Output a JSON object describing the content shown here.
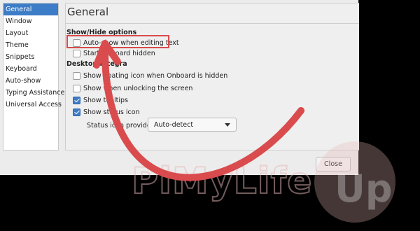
{
  "sidebar": {
    "items": [
      {
        "label": "General",
        "selected": true
      },
      {
        "label": "Window"
      },
      {
        "label": "Layout"
      },
      {
        "label": "Theme"
      },
      {
        "label": "Snippets"
      },
      {
        "label": "Keyboard"
      },
      {
        "label": "Auto-show"
      },
      {
        "label": "Typing Assistance"
      },
      {
        "label": "Universal Access"
      }
    ]
  },
  "panel": {
    "title": "General",
    "show_hide": {
      "title": "Show/Hide options",
      "auto_show": {
        "label": "Auto-show when editing text",
        "checked": false
      },
      "start_hidden": {
        "label": "Start Onboard hidden",
        "checked": false
      }
    },
    "desktop": {
      "title": "Desktop Integra",
      "floating_icon": {
        "label": "Show floating icon when Onboard is hidden",
        "checked": false
      },
      "unlocking": {
        "label": "Show when unlocking the screen",
        "checked": false
      },
      "tooltips": {
        "label": "Show tooltips",
        "checked": true
      },
      "status_icon": {
        "label": "Show status icon",
        "checked": true
      },
      "provider_label": "Status icon provider:",
      "provider_value": "Auto-detect"
    }
  },
  "close_label": "Close",
  "watermark": {
    "text": "PiMyLife",
    "logo_text": "Up"
  },
  "colors": {
    "accent": "#3d7cc6",
    "annotation": "#d94b4d",
    "watermark": "#e8b8b8"
  },
  "icons": {
    "checkbox_checked": "checkmark-icon",
    "dropdown": "chevron-down-icon",
    "arrow": "curved-arrow-annotation"
  }
}
